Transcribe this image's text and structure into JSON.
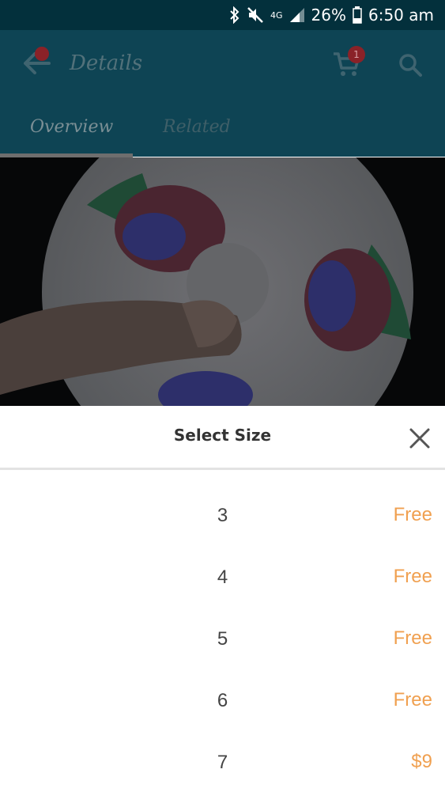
{
  "status_bar": {
    "network": "4G",
    "battery": "26%",
    "time": "6:50 am",
    "icons": [
      "bluetooth-icon",
      "mute-icon",
      "signal-icon",
      "battery-icon"
    ]
  },
  "app_bar": {
    "title": "Details",
    "cart_count": "1",
    "icons": [
      "back-arrow-icon",
      "cart-icon",
      "search-icon"
    ]
  },
  "tabs": [
    {
      "label": "Overview",
      "selected": true
    },
    {
      "label": "Related",
      "selected": false
    }
  ],
  "sheet": {
    "title": "Select Size",
    "close_icon": "close-icon",
    "sizes": [
      {
        "size": "3",
        "price": "Free"
      },
      {
        "size": "4",
        "price": "Free"
      },
      {
        "size": "5",
        "price": "Free"
      },
      {
        "size": "6",
        "price": "Free"
      },
      {
        "size": "7",
        "price": "$9"
      }
    ]
  },
  "colors": {
    "price_accent": "#f0a050",
    "app_bar_dimmed": "#0e4454",
    "status_bar": "#03303c"
  }
}
